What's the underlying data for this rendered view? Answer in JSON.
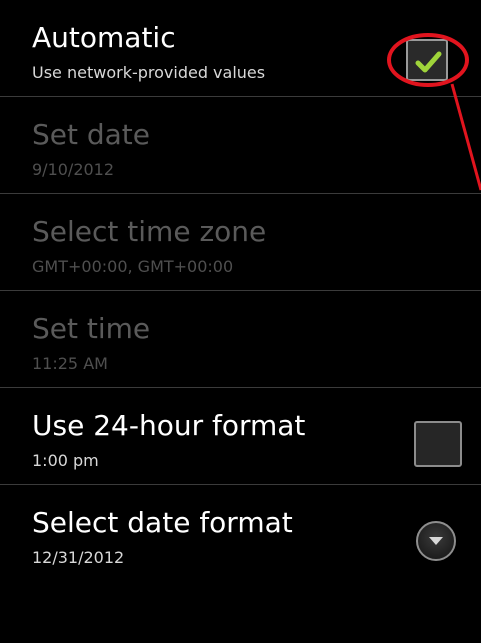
{
  "settings": {
    "items": [
      {
        "title": "Automatic",
        "summary": "Use network-provided values",
        "enabled": true,
        "control": "checkbox",
        "checked": true
      },
      {
        "title": "Set date",
        "summary": "9/10/2012",
        "enabled": false,
        "control": "none"
      },
      {
        "title": "Select time zone",
        "summary": "GMT+00:00, GMT+00:00",
        "enabled": false,
        "control": "none"
      },
      {
        "title": "Set time",
        "summary": "11:25 AM",
        "enabled": false,
        "control": "none"
      },
      {
        "title": "Use 24-hour format",
        "summary": "1:00 pm",
        "enabled": true,
        "control": "checkbox",
        "checked": false
      },
      {
        "title": "Select date format",
        "summary": "12/31/2012",
        "enabled": true,
        "control": "dropdown"
      }
    ]
  },
  "icons": {
    "check": "checkmark-icon",
    "dropdown": "chevron-down-icon"
  },
  "colors": {
    "background": "#000000",
    "checkmark": "#9fd43a",
    "annotation": "#e1141e",
    "enabled_text": "#ffffff",
    "disabled_text": "#5a5a5a"
  }
}
